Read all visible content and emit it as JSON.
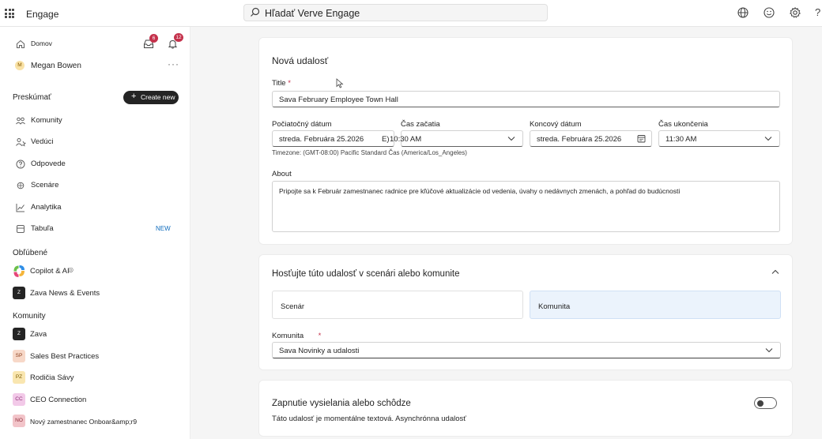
{
  "app": {
    "name": "Engage"
  },
  "search": {
    "placeholder": "Hľadať Verve Engage"
  },
  "sidebar": {
    "home": "Domov",
    "inbox_count": "6",
    "notif_count": "12",
    "user": {
      "initial": "M",
      "name": "Megan Bowen"
    },
    "explore_label": "Preskúmať",
    "create_label": "Create new",
    "nav": [
      {
        "label": "Komunity",
        "icon": "communities-icon"
      },
      {
        "label": "Vedúci",
        "icon": "leaders-icon"
      },
      {
        "label": "Odpovede",
        "icon": "answers-icon"
      },
      {
        "label": "Scenáre",
        "icon": "storylines-icon"
      },
      {
        "label": "Analytika",
        "icon": "analytics-icon"
      },
      {
        "label": "Tabuľa",
        "icon": "board-icon",
        "badge": "NEW"
      }
    ],
    "favorites_label": "Obľúbené",
    "favorites": [
      {
        "label": "Copilot & AI",
        "avatar": ""
      },
      {
        "label": "Zava News & Events",
        "avatar": "Z"
      }
    ],
    "communities_label": "Komunity",
    "communities": [
      {
        "label": "Zava",
        "avatar": "Z"
      },
      {
        "label": "Sales Best Practices",
        "avatar": "SP"
      },
      {
        "label": "Rodičia Sávy",
        "avatar": "PZ"
      },
      {
        "label": "CEO Connection",
        "avatar": "CC"
      },
      {
        "label": "Nový zamestnanec Onboar&amp;r9",
        "avatar": "NO"
      }
    ]
  },
  "event": {
    "heading": "Nová udalosť",
    "title_label": "Title",
    "title_value": "Sava February Employee Town Hall",
    "start_date_label": "Počiatočný dátum",
    "start_date_value": "streda. Februára 25.2026",
    "start_time_label": "Čas začatia",
    "start_time_prefix": "E)",
    "start_time_value": "10:30 AM",
    "end_date_label": "Koncový dátum",
    "end_date_value": "streda. Februára 25.2026",
    "end_time_label": "Čas ukončenia",
    "end_time_value": "11:30 AM",
    "timezone": "Timezone: (GMT-08:00) Pacific Standard Čas  (America/Los_Angeles)",
    "about_label": "About",
    "about_value": "Pripojte sa k Február zamestnanec radnice pre kľúčové aktualizácie od vedenia, úvahy o nedávnych zmenách, a pohľad do budúcnosti"
  },
  "host": {
    "heading": "Hosťujte túto udalosť v scenári alebo komunite",
    "option_storyline": "Scenár",
    "option_community": "Komunita",
    "community_label": "Komunita",
    "community_value": "Sava Novinky a udalosti"
  },
  "broadcast": {
    "heading": "Zapnutie vysielania alebo schôdze",
    "description": "Táto udalosť je momentálne textová. Asynchrónna udalosť"
  },
  "colors": {
    "accent": "#0f6cbd",
    "badge": "#c4314b",
    "selected": "#ebf3fc"
  }
}
